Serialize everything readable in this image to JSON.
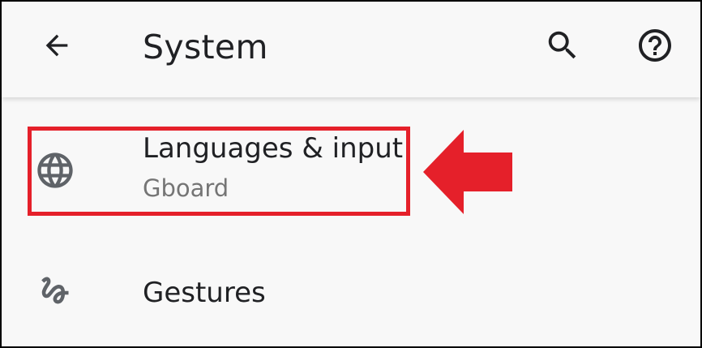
{
  "appbar": {
    "title": "System",
    "back_icon": "arrow-back-icon",
    "search_icon": "search-icon",
    "help_icon": "help-icon"
  },
  "items": [
    {
      "icon": "globe-icon",
      "title": "Languages & input",
      "subtitle": "Gboard"
    },
    {
      "icon": "gesture-icon",
      "title": "Gestures"
    }
  ],
  "annotation": {
    "highlight_color": "#e5202a",
    "arrow_color": "#e5202a"
  },
  "colors": {
    "background": "#f8f8f8",
    "text_primary": "#202124",
    "text_secondary": "#757575",
    "icon": "#5f6368"
  }
}
